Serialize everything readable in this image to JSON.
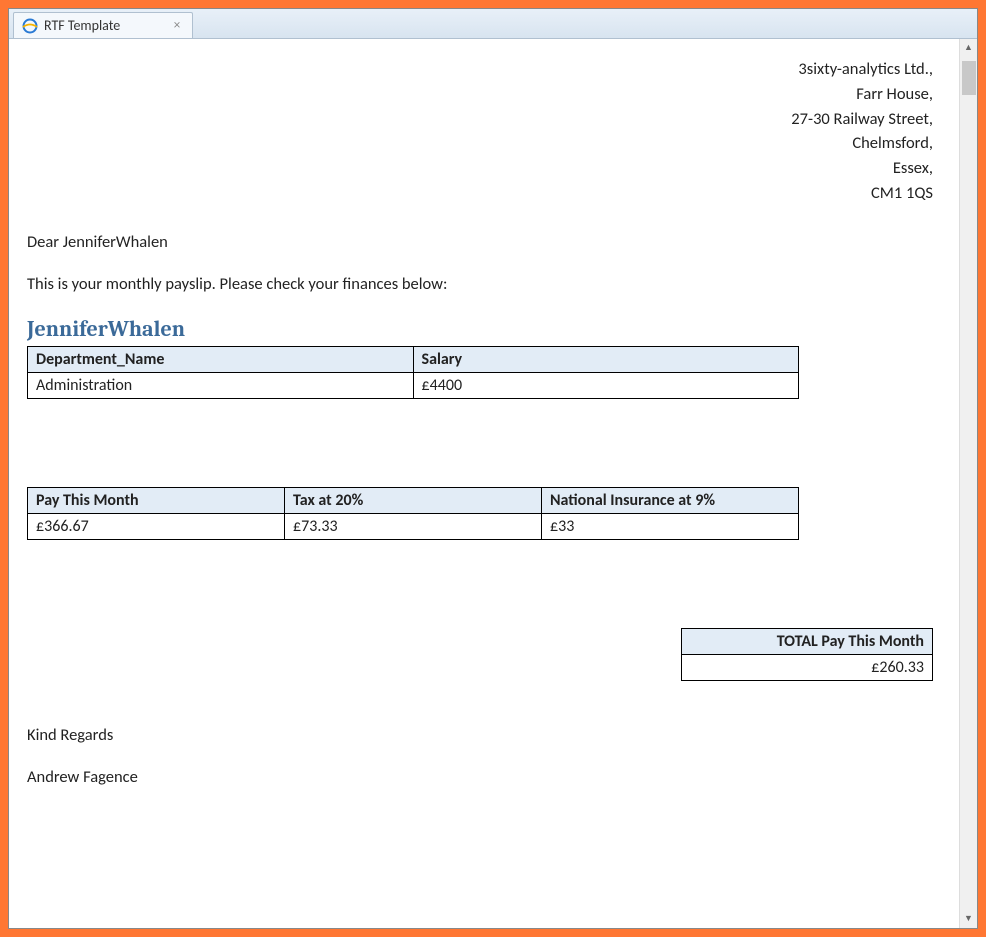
{
  "tab": {
    "title": "RTF Template",
    "close_glyph": "×"
  },
  "address": {
    "line1": "3sixty-analytics Ltd.,",
    "line2": "Farr House,",
    "line3": "27-30 Railway Street,",
    "line4": "Chelmsford,",
    "line5": "Essex,",
    "line6": "CM1 1QS"
  },
  "greeting": "Dear JenniferWhalen",
  "intro": "This is your monthly payslip. Please check your finances below:",
  "recipient_name": "JenniferWhalen",
  "dept_table": {
    "headers": {
      "dept": "Department_Name",
      "salary": "Salary"
    },
    "row": {
      "dept": "Administration",
      "salary": "£4400"
    }
  },
  "pay_table": {
    "headers": {
      "pay": "Pay This Month",
      "tax": "Tax at 20%",
      "ni": "National Insurance at 9%"
    },
    "row": {
      "pay": "£366.67",
      "tax": "£73.33",
      "ni": "£33"
    }
  },
  "total": {
    "label": "TOTAL Pay This Month",
    "value": "£260.33"
  },
  "regards": "Kind Regards",
  "signature": "Andrew Fagence",
  "scroll": {
    "up": "▲",
    "down": "▼"
  }
}
